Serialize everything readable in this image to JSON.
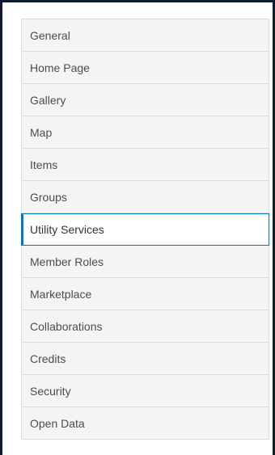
{
  "sidebar": {
    "items": [
      {
        "label": "General"
      },
      {
        "label": "Home Page"
      },
      {
        "label": "Gallery"
      },
      {
        "label": "Map"
      },
      {
        "label": "Items"
      },
      {
        "label": "Groups"
      },
      {
        "label": "Utility Services",
        "active": true
      },
      {
        "label": "Member Roles"
      },
      {
        "label": "Marketplace"
      },
      {
        "label": "Collaborations"
      },
      {
        "label": "Credits"
      },
      {
        "label": "Security"
      },
      {
        "label": "Open Data"
      }
    ]
  },
  "colors": {
    "active_accent": "#0079c1",
    "item_background": "#f4f4f4",
    "item_border": "#dcdcdc",
    "frame_border": "#0b1a2c"
  }
}
